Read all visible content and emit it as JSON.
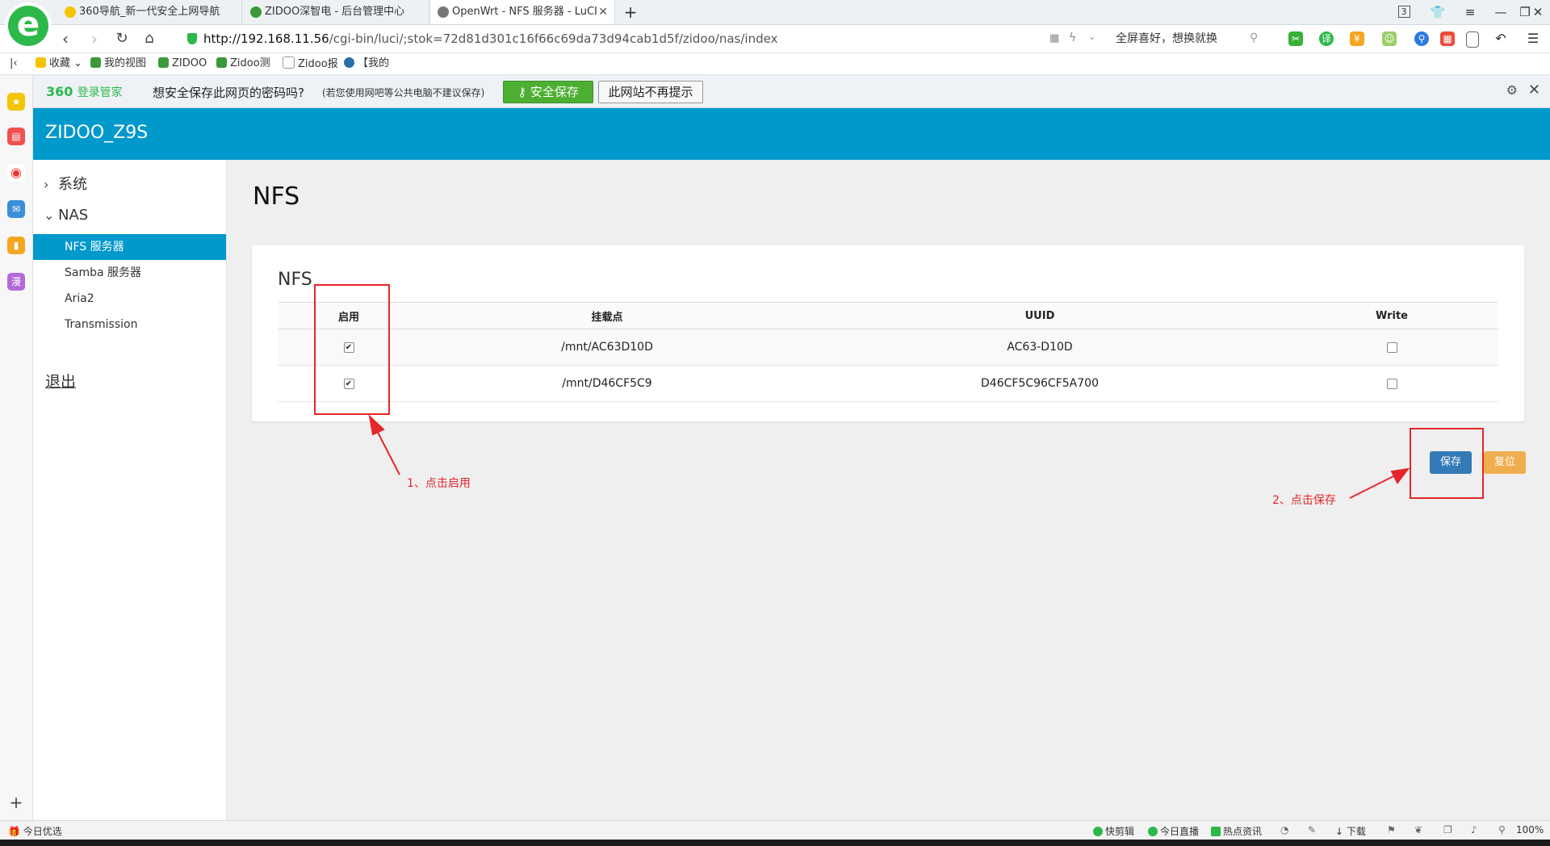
{
  "browser": {
    "tabs": [
      {
        "title": "360导航_新一代安全上网导航",
        "active": false,
        "color": "#f5c400"
      },
      {
        "title": "ZIDOO深智电 - 后台管理中心",
        "active": false,
        "color": "#3a9a3a"
      },
      {
        "title": "OpenWrt - NFS 服务器 - LuCI",
        "active": true,
        "color": "#777777"
      }
    ],
    "new_tab": "+",
    "tab_count": "3",
    "url_host": "http://192.168.11.56",
    "url_path": "/cgi-bin/luci/;stok=72d81d301c16f66c69da73d94cab1d5f/zidoo/nas/index",
    "search_text": "全屏喜好，想换就换",
    "bookmarks": [
      "收藏",
      "我的视图",
      "ZIDOO",
      "Zidoo测",
      "Zidoo报",
      "【我的"
    ],
    "status_left": "今日优选",
    "status_items": [
      "快剪辑",
      "今日直播",
      "热点资讯",
      "下载"
    ],
    "zoom": "100%"
  },
  "password_bar": {
    "brand": "360",
    "brand_sub": "登录管家",
    "question": "想安全保存此网页的密码吗?",
    "note": "(若您使用网吧等公共电脑不建议保存)",
    "save_label": "安全保存",
    "never_label": "此网站不再提示"
  },
  "header": {
    "hostname": "ZIDOO_Z9S"
  },
  "menu": {
    "system": "系统",
    "nas": "NAS",
    "items": [
      "NFS 服务器",
      "Samba 服务器",
      "Aria2",
      "Transmission"
    ],
    "logout": "退出"
  },
  "main": {
    "title": "NFS",
    "section_title": "NFS",
    "columns": [
      "启用",
      "挂载点",
      "UUID",
      "Write"
    ],
    "rows": [
      {
        "enabled": true,
        "mount": "/mnt/AC63D10D",
        "uuid": "AC63-D10D",
        "write": false
      },
      {
        "enabled": true,
        "mount": "/mnt/D46CF5C9",
        "uuid": "D46CF5C96CF5A700",
        "write": false
      }
    ],
    "save_label": "保存",
    "reset_label": "复位"
  },
  "annotations": {
    "step1": "1、点击启用",
    "step2": "2、点击保存"
  },
  "colors": {
    "accent": "#0099cc",
    "save": "#337ab7",
    "reset": "#f0ad4e",
    "annotation": "#e6262a"
  }
}
